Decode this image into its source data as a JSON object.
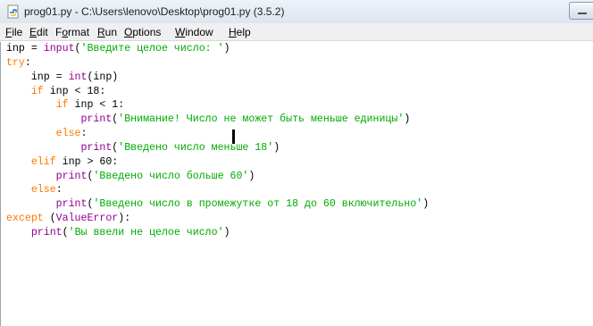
{
  "window": {
    "title": "prog01.py - C:\\Users\\lenovo\\Desktop\\prog01.py (3.5.2)"
  },
  "menu": {
    "items": [
      {
        "pre": "",
        "ul": "F",
        "post": "ile"
      },
      {
        "pre": "",
        "ul": "E",
        "post": "dit"
      },
      {
        "pre": "F",
        "ul": "o",
        "post": "rmat"
      },
      {
        "pre": "",
        "ul": "R",
        "post": "un"
      },
      {
        "pre": "",
        "ul": "O",
        "post": "ptions"
      },
      {
        "pre": "",
        "ul": "W",
        "post": "indow"
      },
      {
        "pre": "",
        "ul": "H",
        "post": "elp"
      }
    ]
  },
  "editor": {
    "lines": [
      [
        {
          "t": "inp = ",
          "c": ""
        },
        {
          "t": "input",
          "c": "bi"
        },
        {
          "t": "(",
          "c": ""
        },
        {
          "t": "'Введите целое число: '",
          "c": "st"
        },
        {
          "t": ")",
          "c": ""
        }
      ],
      [
        {
          "t": "try",
          "c": "kw"
        },
        {
          "t": ":",
          "c": ""
        }
      ],
      [
        {
          "t": "    inp = ",
          "c": ""
        },
        {
          "t": "int",
          "c": "bi"
        },
        {
          "t": "(inp)",
          "c": ""
        }
      ],
      [
        {
          "t": "    ",
          "c": ""
        },
        {
          "t": "if",
          "c": "kw"
        },
        {
          "t": " inp < 18:",
          "c": ""
        }
      ],
      [
        {
          "t": "        ",
          "c": ""
        },
        {
          "t": "if",
          "c": "kw"
        },
        {
          "t": " inp < 1:",
          "c": ""
        }
      ],
      [
        {
          "t": "            ",
          "c": ""
        },
        {
          "t": "print",
          "c": "bi"
        },
        {
          "t": "(",
          "c": ""
        },
        {
          "t": "'Внимание! Число не может быть меньше единицы'",
          "c": "st"
        },
        {
          "t": ")",
          "c": ""
        }
      ],
      [
        {
          "t": "        ",
          "c": ""
        },
        {
          "t": "else",
          "c": "kw"
        },
        {
          "t": ":",
          "c": ""
        }
      ],
      [
        {
          "t": "            ",
          "c": ""
        },
        {
          "t": "print",
          "c": "bi"
        },
        {
          "t": "(",
          "c": ""
        },
        {
          "t": "'Введено число меньше 18'",
          "c": "st"
        },
        {
          "t": ")",
          "c": ""
        }
      ],
      [
        {
          "t": "    ",
          "c": ""
        },
        {
          "t": "elif",
          "c": "kw"
        },
        {
          "t": " inp > 60:",
          "c": ""
        }
      ],
      [
        {
          "t": "        ",
          "c": ""
        },
        {
          "t": "print",
          "c": "bi"
        },
        {
          "t": "(",
          "c": ""
        },
        {
          "t": "'Введено число больше 60'",
          "c": "st"
        },
        {
          "t": ")",
          "c": ""
        }
      ],
      [
        {
          "t": "    ",
          "c": ""
        },
        {
          "t": "else",
          "c": "kw"
        },
        {
          "t": ":",
          "c": ""
        }
      ],
      [
        {
          "t": "        ",
          "c": ""
        },
        {
          "t": "print",
          "c": "bi"
        },
        {
          "t": "(",
          "c": ""
        },
        {
          "t": "'Введено число в промежутке от 18 до 60 включительно'",
          "c": "st"
        },
        {
          "t": ")",
          "c": ""
        }
      ],
      [
        {
          "t": "except",
          "c": "kw"
        },
        {
          "t": " (",
          "c": ""
        },
        {
          "t": "ValueError",
          "c": "bi"
        },
        {
          "t": "):",
          "c": ""
        }
      ],
      [
        {
          "t": "    ",
          "c": ""
        },
        {
          "t": "print",
          "c": "bi"
        },
        {
          "t": "(",
          "c": ""
        },
        {
          "t": "'Вы ввели не целое число'",
          "c": "st"
        },
        {
          "t": ")",
          "c": ""
        }
      ]
    ]
  },
  "colors": {
    "keyword": "#ff7700",
    "builtin": "#900090",
    "string": "#00aa00"
  },
  "icons": {
    "title": "python-file-icon",
    "window_button": "minimize-icon"
  }
}
